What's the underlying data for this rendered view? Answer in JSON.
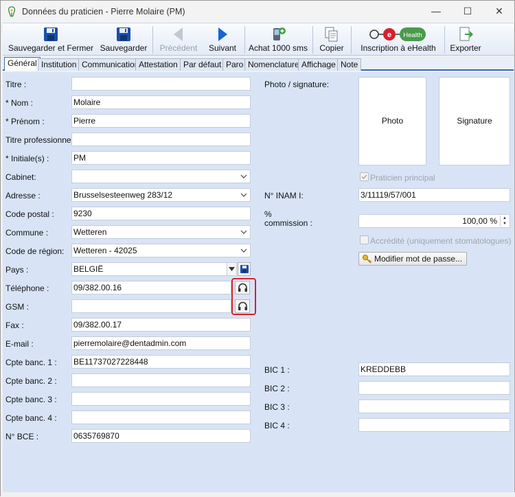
{
  "window": {
    "title": "Données du praticien - Pierre Molaire (PM)",
    "controls": {
      "minimize": "—",
      "maximize": "☐",
      "close": "✕"
    }
  },
  "toolbar": {
    "save_close": "Sauvegarder et Fermer",
    "save": "Sauvegarder",
    "previous": "Précédent",
    "next": "Suivant",
    "buy_sms": "Achat 1000 sms",
    "copy": "Copier",
    "ehealth": "Inscription à eHealth",
    "ehealth_logo_text": "Health",
    "ehealth_logo_e": "e",
    "export": "Exporter"
  },
  "tabs": [
    "Général",
    "Institution",
    "Communication",
    "Attestation",
    "Par défaut",
    "Paro",
    "Nomenclature",
    "Affichage",
    "Note"
  ],
  "active_tab": "Général",
  "form": {
    "titre": {
      "label": "Titre :",
      "value": ""
    },
    "nom": {
      "label": "* Nom :",
      "value": "Molaire"
    },
    "prenom": {
      "label": "* Prénom :",
      "value": "Pierre"
    },
    "titre_pro": {
      "label": "Titre professionnel :",
      "value": ""
    },
    "initiales": {
      "label": "* Initiale(s) :",
      "value": "PM"
    },
    "cabinet": {
      "label": "Cabinet:",
      "value": ""
    },
    "adresse": {
      "label": "Adresse :",
      "value": "Brusselsesteenweg 283/12"
    },
    "code_postal": {
      "label": "Code postal :",
      "value": "9230"
    },
    "commune": {
      "label": "Commune :",
      "value": "Wetteren"
    },
    "code_region": {
      "label": "Code de région:",
      "value": "Wetteren - 42025"
    },
    "pays": {
      "label": "Pays :",
      "value": "BELGIË"
    },
    "telephone": {
      "label": "Téléphone :",
      "value": "09/382.00.16"
    },
    "gsm": {
      "label": "GSM :",
      "value": ""
    },
    "fax": {
      "label": "Fax :",
      "value": "09/382.00.17"
    },
    "email": {
      "label": "E-mail :",
      "value": "pierremolaire@dentadmin.com"
    },
    "cpte1": {
      "label": "Cpte banc. 1 :",
      "value": "BE11737027228448"
    },
    "cpte2": {
      "label": "Cpte banc. 2 :",
      "value": ""
    },
    "cpte3": {
      "label": "Cpte banc. 3 :",
      "value": ""
    },
    "cpte4": {
      "label": "Cpte banc. 4 :",
      "value": ""
    },
    "bce": {
      "label": "N° BCE :",
      "value": "0635769870"
    }
  },
  "right": {
    "photo_sig_label": "Photo / signature:",
    "photo": "Photo",
    "signature": "Signature",
    "praticien_principal": "Praticien principal",
    "inami_label": "N° INAM I:",
    "inami_value": "3/11119/57/001",
    "commission_label_1": "%",
    "commission_label_2": "commission :",
    "commission_value": "100,00 %",
    "accredite": "Accrédité (uniquement stomatologues)",
    "modify_password": "Modifier mot de passe...",
    "bic1": {
      "label": "BIC 1 :",
      "value": "KREDDEBB"
    },
    "bic2": {
      "label": "BIC 2 :",
      "value": ""
    },
    "bic3": {
      "label": "BIC 3 :",
      "value": ""
    },
    "bic4": {
      "label": "BIC 4 :",
      "value": ""
    }
  },
  "colors": {
    "content_bg": "#d8e4f6",
    "accent_blue": "#3a66b0",
    "highlight_red": "#d8202b",
    "ehealth_red": "#d8202b",
    "ehealth_green": "#4a9a4c"
  },
  "icons": [
    "app-logo-icon",
    "save-close-icon",
    "save-icon",
    "previous-arrow-icon",
    "next-arrow-icon",
    "sms-phone-icon",
    "copy-icon",
    "ehealth-logo-icon",
    "export-icon",
    "chevron-down-icon",
    "headset-icon",
    "floppy-save-icon",
    "password-key-icon"
  ]
}
